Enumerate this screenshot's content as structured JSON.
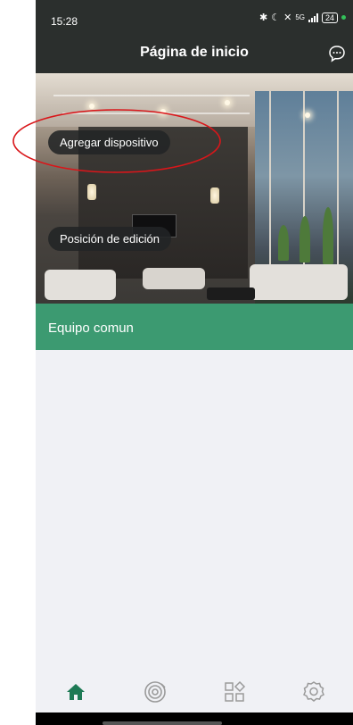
{
  "status_bar": {
    "time": "15:28",
    "network": "5G",
    "battery": "24"
  },
  "header": {
    "title": "Página de inicio",
    "chat_icon": "message-bubble-icon"
  },
  "hero": {
    "add_device_label": "Agregar dispositivo",
    "edit_position_label": "Posición de edición"
  },
  "section": {
    "label": "Equipo comun"
  },
  "bottom_nav": {
    "items": [
      {
        "icon": "home-icon",
        "active": true
      },
      {
        "icon": "scan-icon",
        "active": false
      },
      {
        "icon": "apps-grid-icon",
        "active": false
      },
      {
        "icon": "settings-gear-icon",
        "active": false
      }
    ],
    "active_color": "#1e7a55",
    "inactive_color": "#9a9a9a"
  },
  "colors": {
    "header_bg": "#2b2f2d",
    "section_band": "#3c9a71",
    "annotation_ellipse": "#d9161a"
  }
}
